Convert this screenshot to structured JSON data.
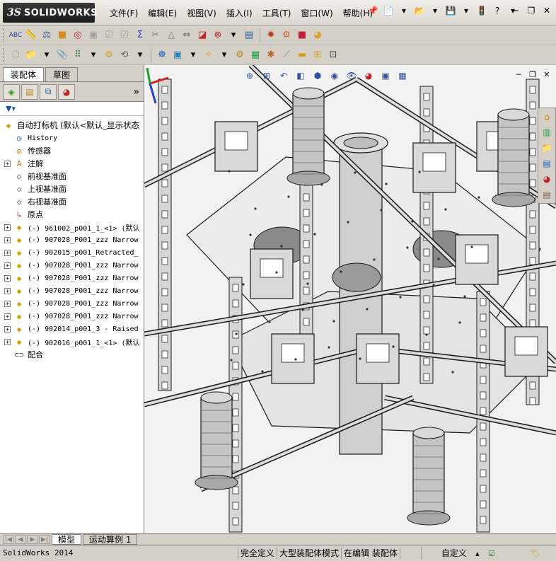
{
  "app": {
    "logo_ds": "3S",
    "logo_brand": "SOLIDWORKS"
  },
  "menu": [
    {
      "label": "文件(F)"
    },
    {
      "label": "编辑(E)"
    },
    {
      "label": "视图(V)"
    },
    {
      "label": "插入(I)"
    },
    {
      "label": "工具(T)"
    },
    {
      "label": "窗口(W)"
    },
    {
      "label": "帮助(H)"
    }
  ],
  "panel": {
    "tabs": [
      "装配体",
      "草图"
    ],
    "active_tab": "装配体"
  },
  "tree": {
    "root": "自动打标机  (默认<默认_显示状态",
    "items": [
      {
        "label": "History",
        "icon": "history-icon",
        "mono": true,
        "expandable": false
      },
      {
        "label": "传感器",
        "icon": "sensor-icon",
        "mono": false,
        "expandable": false
      },
      {
        "label": "注解",
        "icon": "annotation-icon",
        "mono": false,
        "expandable": true
      },
      {
        "label": "前视基准面",
        "icon": "plane-icon",
        "mono": false,
        "expandable": false
      },
      {
        "label": "上视基准面",
        "icon": "plane-icon",
        "mono": false,
        "expandable": false
      },
      {
        "label": "右视基准面",
        "icon": "plane-icon",
        "mono": false,
        "expandable": false
      },
      {
        "label": "原点",
        "icon": "origin-icon",
        "mono": false,
        "expandable": false
      },
      {
        "label": "(-) 961002_p001_1_<1> (默认",
        "icon": "subassembly-icon",
        "mono": true,
        "expandable": true
      },
      {
        "label": "(-) 907028_P001_zzz Narrow",
        "icon": "subassembly-icon",
        "mono": true,
        "expandable": true
      },
      {
        "label": "(-) 902015_p001_Retracted_",
        "icon": "subassembly-icon",
        "mono": true,
        "expandable": true
      },
      {
        "label": "(-) 907028_P001_zzz Narrow",
        "icon": "subassembly-icon",
        "mono": true,
        "expandable": true
      },
      {
        "label": "(-) 907028_P001_zzz Narrow",
        "icon": "subassembly-icon",
        "mono": true,
        "expandable": true
      },
      {
        "label": "(-) 907028_P001_zzz Narrow",
        "icon": "subassembly-icon",
        "mono": true,
        "expandable": true
      },
      {
        "label": "(-) 907028_P001_zzz Narrow",
        "icon": "subassembly-icon",
        "mono": true,
        "expandable": true
      },
      {
        "label": "(-) 907028_P001_zzz Narrow",
        "icon": "subassembly-icon",
        "mono": true,
        "expandable": true
      },
      {
        "label": "(-) 902014_p001_3 - Raised",
        "icon": "subassembly-icon",
        "mono": true,
        "expandable": true
      },
      {
        "label": "(-) 902016_p001_1_<1> (默认",
        "icon": "subassembly-icon",
        "mono": true,
        "expandable": true
      },
      {
        "label": "配合",
        "icon": "mates-icon",
        "mono": false,
        "expandable": false
      }
    ]
  },
  "bottom_tabs": [
    "模型",
    "运动算例 1"
  ],
  "status": {
    "app_name": "SolidWorks 2014",
    "fully_defined": "完全定义",
    "large_assembly": "大型装配体模式",
    "editing": "在编辑 装配体",
    "custom": "自定义"
  },
  "colors": {
    "chrome": "#d4d0c8",
    "model_fill": "#d9d9d9",
    "model_edge": "#1a1a1a"
  }
}
